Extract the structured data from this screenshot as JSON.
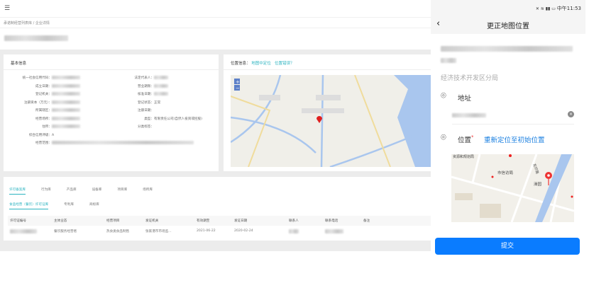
{
  "header": {
    "menu_icon": "menu-fold-icon"
  },
  "breadcrumb": {
    "parent": "承诺制经营列表库",
    "separator": "/",
    "current": "企业详情"
  },
  "basic_info": {
    "title": "基本信息",
    "left_fields": [
      {
        "label": "统一社会信用代码：",
        "value": ""
      },
      {
        "label": "成立日期：",
        "value": ""
      },
      {
        "label": "登记机关：",
        "value": ""
      },
      {
        "label": "注册资本（万元）：",
        "value": ""
      },
      {
        "label": "所属辖区：",
        "value": ""
      },
      {
        "label": "经营场所：",
        "value": ""
      },
      {
        "label": "住所：",
        "value": ""
      },
      {
        "label": "综合信用评级：",
        "value": "A"
      },
      {
        "label": "经营范围：",
        "value": ""
      }
    ],
    "right_fields": [
      {
        "label": "法定代表人：",
        "value": ""
      },
      {
        "label": "营业期限：",
        "value": ""
      },
      {
        "label": "核准日期：",
        "value": ""
      },
      {
        "label": "登记状态：",
        "value": "正常"
      },
      {
        "label": "注册日期：",
        "value": ""
      },
      {
        "label": "类型：",
        "value": "有限责任公司(自然人投资或控股)"
      },
      {
        "label": "分类标签：",
        "value": ""
      }
    ]
  },
  "location": {
    "label": "位置信息：",
    "locate_link": "地图中定位",
    "error_link": "位置错误？",
    "zoom_in": "+",
    "zoom_out": "−"
  },
  "tabs": [
    "许可备案库",
    "行为库",
    "产品库",
    "设备库",
    "项目库",
    "场所库"
  ],
  "subtabs": [
    "食品经营（餐饮）许可证库",
    "专利库",
    "商标库"
  ],
  "table": {
    "headers": [
      "许可证编号",
      "主体业态",
      "经营项目",
      "发证机关",
      "有效期至",
      "发证日期",
      "联系人",
      "联系电话",
      "备注"
    ],
    "rows": [
      [
        "",
        "餐饮服务经营者",
        "热食类食品制售",
        "张家港市市场监...",
        "2021-06-22",
        "2020-02-24",
        "",
        "",
        ""
      ]
    ]
  },
  "phone": {
    "time": "中午11:53",
    "title": "更正地图位置",
    "org": "经济技术开发区分局",
    "address_label": "地址",
    "position_label": "位置",
    "required_mark": "*",
    "relocate_link": "重新定位至初始位置",
    "map_labels": [
      "资源和规划局",
      "市信访局",
      "东环路",
      "澡园"
    ],
    "submit": "提交",
    "accent": "#0a7cff"
  }
}
